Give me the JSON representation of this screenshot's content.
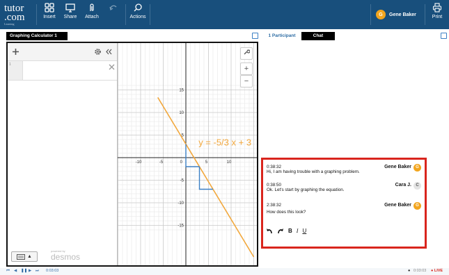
{
  "app": {
    "logo_line1": "tutor",
    "logo_line2": ".com",
    "logo_tag": "Learning"
  },
  "toolbar": [
    {
      "label": "Insert",
      "icon": "grid-icon",
      "enabled": true
    },
    {
      "label": "Share",
      "icon": "monitor-icon",
      "enabled": true
    },
    {
      "label": "Attach",
      "icon": "paperclip-icon",
      "enabled": true
    },
    {
      "label": "",
      "icon": "undo-icon",
      "enabled": false
    },
    {
      "label": "Actions",
      "icon": "search-icon",
      "enabled": true
    }
  ],
  "user": {
    "name": "Gene Baker",
    "initial": "G"
  },
  "print_label": "Print",
  "left_tab": "Graphing Calculator 1",
  "right_tabs": {
    "participants": "1 Participant",
    "chat": "Chat"
  },
  "calculator": {
    "expression": "",
    "brand_small": "powered by",
    "brand": "desmos",
    "graph": {
      "x_ticks": [
        "-10",
        "-5",
        "0",
        "5",
        "10"
      ],
      "y_ticks": [
        "15",
        "10",
        "5",
        "-5",
        "-10",
        "-15"
      ],
      "annotation": "y = -5/3 x + 3",
      "line_color": "#f2a73b",
      "slope_color": "#3b7fc4"
    }
  },
  "chat": {
    "messages": [
      {
        "time": "0:38:32",
        "sender": "Gene Baker",
        "initial": "G",
        "text": "Hi, I am having trouble with a graphing problem."
      },
      {
        "time": "0:38:50",
        "sender": "Cara J.",
        "initial": "C",
        "text": "Ok. Let's start by graphing the equation."
      },
      {
        "time": "2:38:32",
        "sender": "Gene Baker",
        "initial": "G",
        "text": "How does this look?"
      }
    ],
    "format_bold": "B",
    "format_italic": "I",
    "format_underline": "U"
  },
  "playback": {
    "left_time": "0:03:03",
    "right_time": "0:03:03",
    "live": "LIVE"
  },
  "colors": {
    "topbar": "#184f7c",
    "highlight": "#d9251d",
    "avatar": "#f2a51e"
  }
}
